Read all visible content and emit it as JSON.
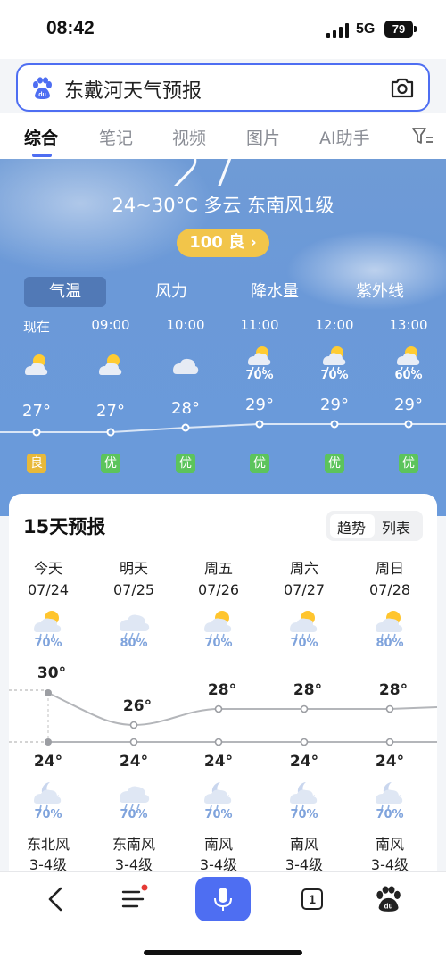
{
  "status": {
    "time": "08:42",
    "network": "5G",
    "battery": "79"
  },
  "search": {
    "query": "东戴河天气预报"
  },
  "tabs": [
    "综合",
    "笔记",
    "视频",
    "图片",
    "AI助手"
  ],
  "current": {
    "temp_partial": "27",
    "summary": "24~30°C 多云 东南风1级",
    "aqi": "100 良 ›"
  },
  "metric_tabs": [
    "气温",
    "风力",
    "降水量",
    "紫外线"
  ],
  "hourly": [
    {
      "time": "现在",
      "icon": "partly-sunny-icon",
      "prob": "",
      "temp": "27°",
      "aq": "良"
    },
    {
      "time": "09:00",
      "icon": "partly-sunny-icon",
      "prob": "",
      "temp": "27°",
      "aq": "优"
    },
    {
      "time": "10:00",
      "icon": "cloud-icon",
      "prob": "",
      "temp": "28°",
      "aq": "优"
    },
    {
      "time": "11:00",
      "icon": "sun-rain-icon",
      "prob": "70%",
      "temp": "29°",
      "aq": "优"
    },
    {
      "time": "12:00",
      "icon": "sun-rain-icon",
      "prob": "70%",
      "temp": "29°",
      "aq": "优"
    },
    {
      "time": "13:00",
      "icon": "sun-rain-icon",
      "prob": "60%",
      "temp": "29°",
      "aq": "优"
    }
  ],
  "forecast": {
    "title": "15天预报",
    "toggle": [
      "趋势",
      "列表"
    ],
    "days": [
      {
        "name": "今天",
        "date": "07/24",
        "day_prob": "70%",
        "high": "30°",
        "low": "24°",
        "night_prob": "70%",
        "wind": "东北风",
        "level": "3-4级"
      },
      {
        "name": "明天",
        "date": "07/25",
        "day_prob": "80%",
        "high": "26°",
        "low": "24°",
        "night_prob": "70%",
        "wind": "东南风",
        "level": "3-4级"
      },
      {
        "name": "周五",
        "date": "07/26",
        "day_prob": "70%",
        "high": "28°",
        "low": "24°",
        "night_prob": "70%",
        "wind": "南风",
        "level": "3-4级"
      },
      {
        "name": "周六",
        "date": "07/27",
        "day_prob": "70%",
        "high": "28°",
        "low": "24°",
        "night_prob": "70%",
        "wind": "南风",
        "level": "3-4级"
      },
      {
        "name": "周日",
        "date": "07/28",
        "day_prob": "80%",
        "high": "28°",
        "low": "24°",
        "night_prob": "70%",
        "wind": "南风",
        "level": "3-4级"
      }
    ]
  },
  "bottom": {
    "tab_count": "1"
  },
  "colors": {
    "accent": "#4e6ef2",
    "aq_good": "#e8b93a",
    "aq_excellent": "#5cc45c",
    "aqi_pill": "#f2c54a"
  }
}
